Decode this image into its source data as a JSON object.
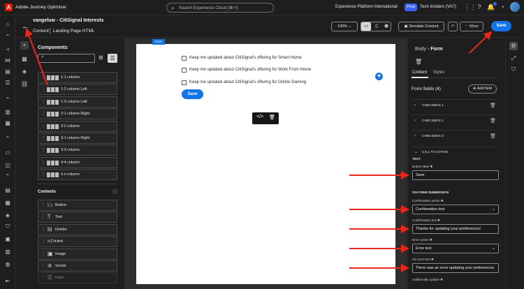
{
  "app": {
    "brand_letter": "A",
    "title": "Adobe Journey Optimizer"
  },
  "search": {
    "placeholder": "Search Experience Cloud (⌘+/)"
  },
  "org": {
    "name": "Experience Platform International",
    "env_badge": "Prod",
    "sandbox": "Tech Insiders (VA7)"
  },
  "header": {
    "title": "vangeluw - CitiSignal Interests",
    "tab_content": "Content",
    "tab_landing": "Landing Page HTML",
    "zoom": "100%",
    "simulate_label": "Simulate Content",
    "more_label": "More",
    "save_label": "Save"
  },
  "components": {
    "heading": "Components",
    "structures": [
      {
        "label": "1:1 column"
      },
      {
        "label": "1:2 column Left"
      },
      {
        "label": "1:3 column Left"
      },
      {
        "label": "2:1 column Right"
      },
      {
        "label": "2:2 column"
      },
      {
        "label": "3:1 column Right"
      },
      {
        "label": "3:3 column"
      },
      {
        "label": "4:4 column"
      },
      {
        "label": "n:n column"
      }
    ],
    "contents_heading": "Contents",
    "contents": [
      {
        "label": "Button",
        "icon": "button-icon",
        "glyph": "▭"
      },
      {
        "label": "Text",
        "icon": "text-icon",
        "glyph": "T"
      },
      {
        "label": "Divider",
        "icon": "divider-icon",
        "glyph": "⊟"
      },
      {
        "label": "Html",
        "icon": "html-icon",
        "glyph": "</>"
      },
      {
        "label": "Image",
        "icon": "image-icon",
        "glyph": "▣"
      },
      {
        "label": "Social",
        "icon": "social-icon",
        "glyph": "⋔"
      },
      {
        "label": "Form",
        "icon": "form-icon",
        "glyph": "☰"
      }
    ]
  },
  "canvas": {
    "form_tag": "Form",
    "checkboxes": [
      {
        "label": "Keep me updated about CitiSignal's offering for Smart Home"
      },
      {
        "label": "Keep me updated about CitiSignal's offering for Work From Home"
      },
      {
        "label": "Keep me updated about CitiSignal's offering for Online Gaming"
      }
    ],
    "save_label": "Save"
  },
  "inspector": {
    "crumb_parent": "Body",
    "crumb_current": "Form",
    "tab_content": "Content",
    "tab_styles": "Styles",
    "form_fields_heading": "Form fields (4)",
    "add_field_label": "Add field",
    "fields": [
      {
        "label": "CHECKBOX 1"
      },
      {
        "label": "CHECKBOX 2"
      },
      {
        "label": "CHECKBOX 3"
      }
    ],
    "cta_label": "CALL TO ACTION",
    "text_section": "TEXT",
    "button_label_label": "Button label ✱",
    "button_label_value": "Save",
    "submission_section": "ON FORM SUBMISSION",
    "confirmation_action_label": "Confirmation action ✱",
    "confirmation_action_value": "Confirmation text",
    "confirmation_text_label": "Confirmation text ✱",
    "confirmation_text_value": "Thanks for updating your preferences!",
    "error_action_label": "Error action ✱",
    "error_action_value": "Error text",
    "error_text_label": "On error text ✱",
    "error_text_value": "There was an error updating your preferences.",
    "additionally_update_label": "Additionally update ✱"
  },
  "colors": {
    "accent": "#1473e6",
    "annotation_arrow": "#e8261c",
    "brand": "#eb1000"
  }
}
